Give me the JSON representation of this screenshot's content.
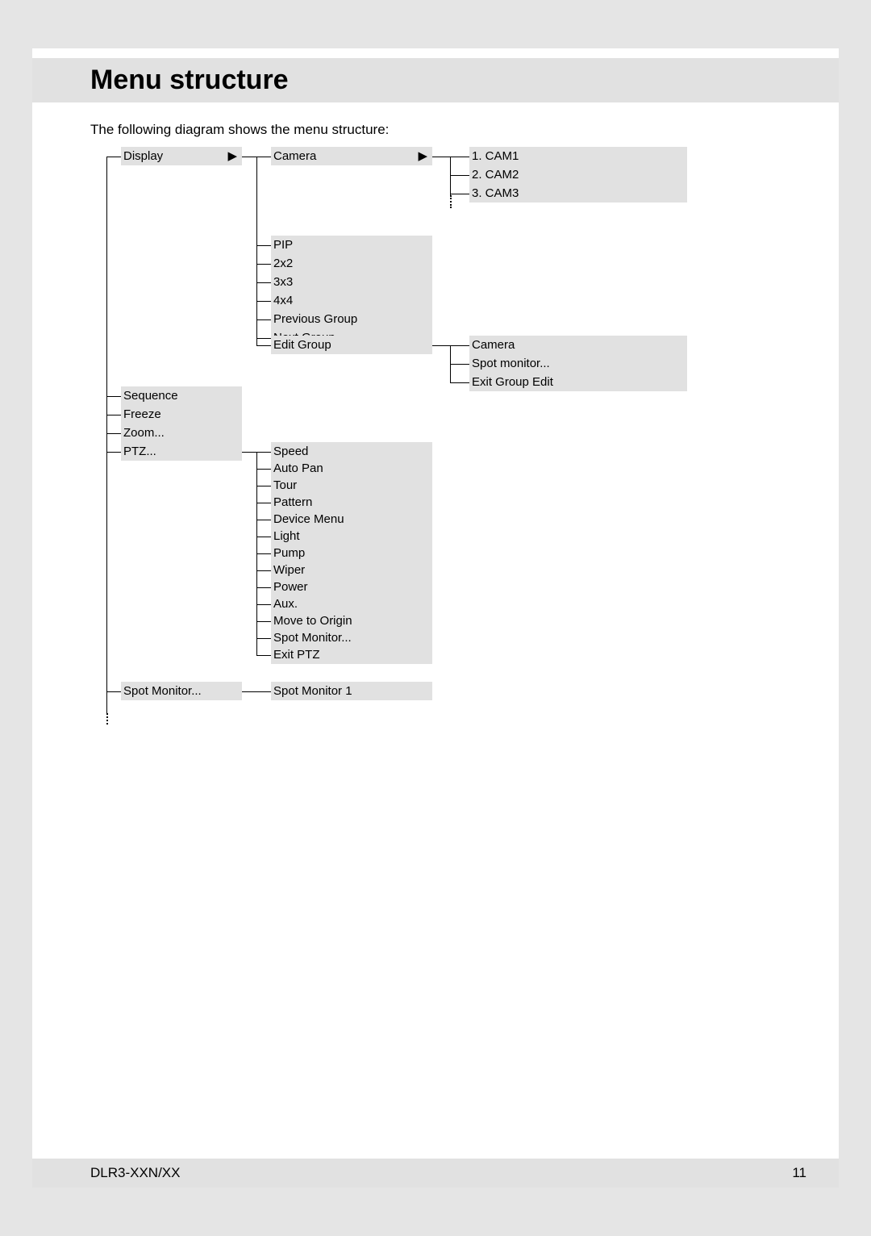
{
  "heading": "Menu structure",
  "intro": "The following diagram shows the menu structure:",
  "footer": {
    "left": "DLR3-XXN/XX",
    "right": "11"
  },
  "col1": {
    "display": "Display",
    "sequence": "Sequence",
    "freeze": "Freeze",
    "zoom": "Zoom...",
    "ptz": "PTZ...",
    "spot_monitor": "Spot Monitor..."
  },
  "col2": {
    "camera": "Camera",
    "pip": "PIP",
    "twoxtwo": "2x2",
    "threexthree": "3x3",
    "fourxfour": "4x4",
    "prev_group": "Previous Group",
    "next_group": "Next Group",
    "edit_group": "Edit Group",
    "speed": "Speed",
    "auto_pan": "Auto Pan",
    "tour": "Tour",
    "pattern": "Pattern",
    "device_menu": "Device Menu",
    "light": "Light",
    "pump": "Pump",
    "wiper": "Wiper",
    "power": "Power",
    "aux": "Aux.",
    "move_origin": "Move to Origin",
    "spot_monitor": "Spot Monitor...",
    "exit_ptz": "Exit PTZ",
    "spot_monitor1": "Spot Monitor 1"
  },
  "col3": {
    "cam1": "1. CAM1",
    "cam2": "2. CAM2",
    "cam3": "3. CAM3",
    "eg_camera": "Camera",
    "eg_spot_monitor": "Spot monitor...",
    "eg_exit": "Exit Group Edit"
  }
}
